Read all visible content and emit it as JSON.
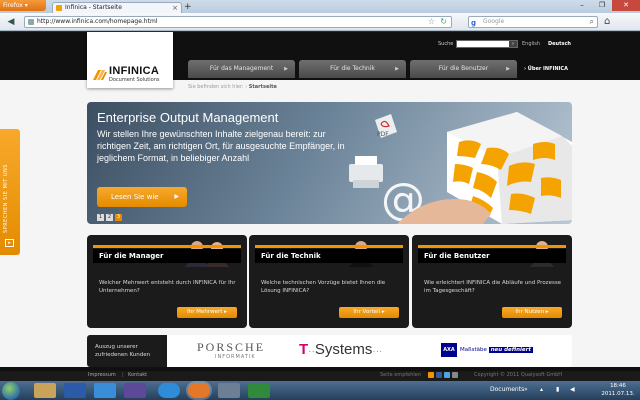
{
  "browser": {
    "menu_button": "Firefox",
    "tab_title": "Infinica - Startseite",
    "new_tab": "+",
    "url": "http://www.infinica.com/homepage.html",
    "search_placeholder": "Google",
    "search_engine": "g"
  },
  "site": {
    "logo_name": "INFINICA",
    "logo_sub": "Document Solutions",
    "search_label": "Suche",
    "lang_en": "English",
    "lang_de": "Deutsch",
    "nav": [
      {
        "label": "Für das Management"
      },
      {
        "label": "Für die Technik"
      },
      {
        "label": "Für die Benutzer"
      }
    ],
    "nav_about": "› Über INFINICA",
    "breadcrumb_prefix": "Sie befinden sich hier:",
    "breadcrumb_current": "Startseite"
  },
  "hero": {
    "title": "Enterprise Output Management",
    "text": "Wir stellen Ihre gewünschten Inhalte zielgenau bereit: zur richtigen Zeit, am richtigen Ort, für ausgesuchte Empfänger, in jeglichem Format, in beliebiger Anzahl",
    "button": "Lesen Sie wie",
    "pager": [
      "1",
      "2",
      "3"
    ],
    "pdf_label": "PDF",
    "at_symbol": "@"
  },
  "sidetab": {
    "label": "SPRECHEN SIE MIT UNS"
  },
  "cards": [
    {
      "title": "Für die Manager",
      "text": "Welcher Mehrwert entsteht durch INFINICA für Ihr Unternehmen?",
      "button": "Ihr Mehrwert"
    },
    {
      "title": "Für die Technik",
      "text": "Welche technischen Vorzüge bietet Ihnen die Lösung INFINICA?",
      "button": "Ihr Vorteil"
    },
    {
      "title": "Für die Benutzer",
      "text": "Wie erleichtert INFINICA die Abläufe und Prozesse im Tagesgeschäft?",
      "button": "Ihr Nutzen"
    }
  ],
  "customers": {
    "label": "Auszug unserer zufriedenen Kunden",
    "porsche": "PORSCHE",
    "porsche_sub": "INFORMATIK",
    "tsystems_t": "T",
    "tsystems_dots_left": "··",
    "tsystems_name": "Systems",
    "tsystems_dots_right": "···",
    "axa": "AXA",
    "axa_slogan": "Maßstäbe",
    "axa_slogan_bold": "neu definiert"
  },
  "footer": {
    "impressum": "Impressum",
    "kontakt": "Kontakt",
    "recommend": "Seite empfehlen",
    "copyright": "Copyright © 2011 Qualysoft GmbH"
  },
  "taskbar": {
    "documents": "Documents",
    "documents_arrow": "»",
    "time": "18:46",
    "date": "2011.07.13."
  },
  "colors": {
    "accent": "#e48b00",
    "dark": "#1b1b1b"
  }
}
